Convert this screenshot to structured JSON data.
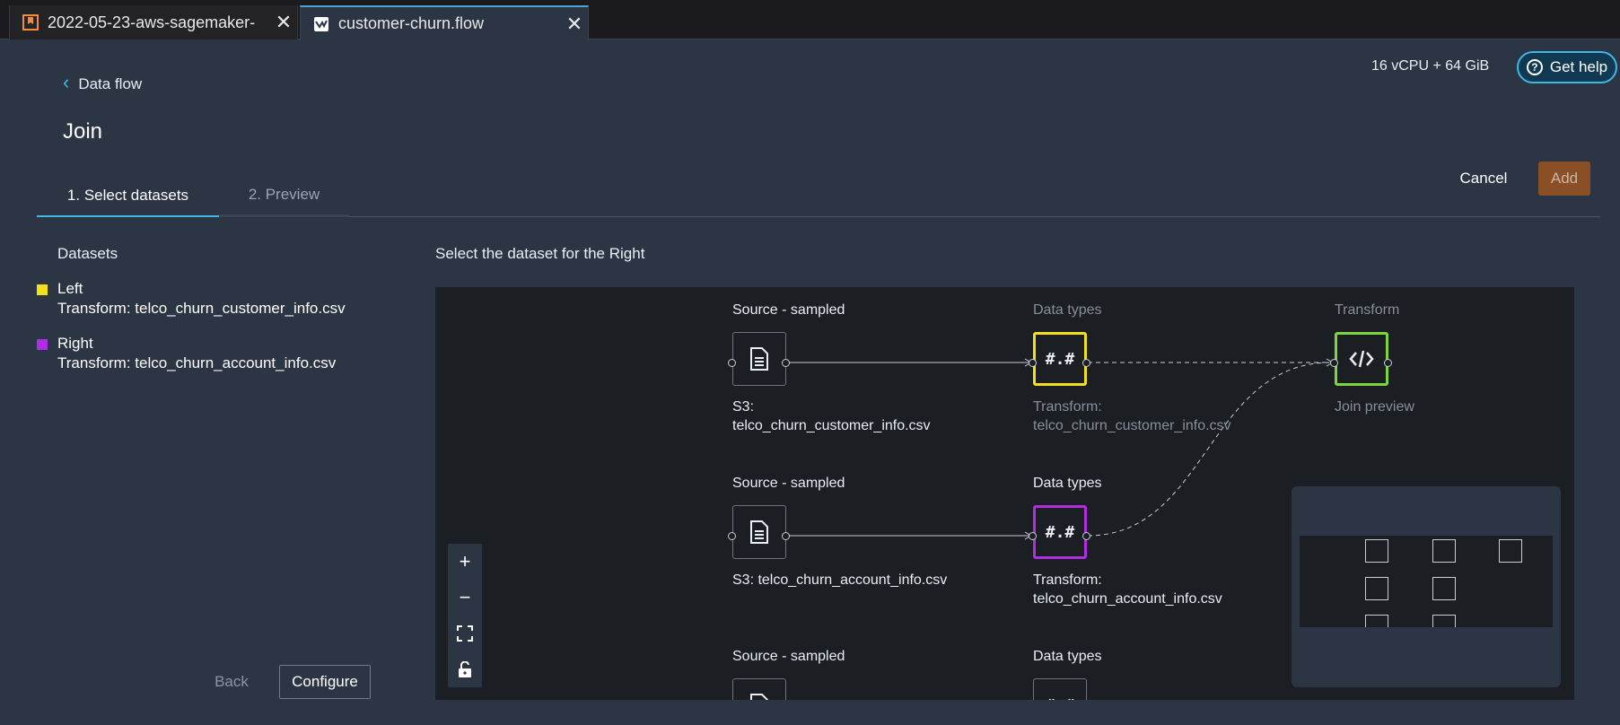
{
  "browser_tabs": [
    {
      "label": "2022-05-23-aws-sagemaker-",
      "icon": "notebook-icon",
      "active": false
    },
    {
      "label": "customer-churn.flow",
      "icon": "flow-icon",
      "active": true
    }
  ],
  "header": {
    "back_link": "Data flow",
    "title": "Join",
    "resource_info": "16 vCPU + 64 GiB",
    "help_label": "Get help"
  },
  "steps": [
    {
      "label": "1. Select datasets",
      "active": true
    },
    {
      "label": "2. Preview",
      "active": false
    }
  ],
  "actions": {
    "cancel_label": "Cancel",
    "add_label": "Add",
    "add_enabled": false
  },
  "datasets_panel": {
    "heading": "Datasets",
    "items": [
      {
        "name": "Left",
        "sub": "Transform: telco_churn_customer_info.csv",
        "color": "#f2e11a"
      },
      {
        "name": "Right",
        "sub": "Transform: telco_churn_account_info.csv",
        "color": "#b12de0"
      }
    ]
  },
  "footer": {
    "back_label": "Back",
    "configure_label": "Configure"
  },
  "canvas": {
    "prompt": "Select the dataset for the Right",
    "rows": [
      {
        "source_heading": "Source - sampled",
        "source_label": "S3:\ntelco_churn_customer_info.csv",
        "dtypes_heading": "Data types",
        "dtypes_glyph": "#.#",
        "dtypes_label": "Transform:\ntelco_churn_customer_info.csv",
        "dtypes_color": "#f2e11a"
      },
      {
        "source_heading": "Source - sampled",
        "source_label": "S3: telco_churn_account_info.csv",
        "dtypes_heading": "Data types",
        "dtypes_glyph": "#.#",
        "dtypes_label": "Transform:\ntelco_churn_account_info.csv",
        "dtypes_color": "#b12de0"
      },
      {
        "source_heading": "Source - sampled",
        "dtypes_heading": "Data types",
        "dtypes_glyph": "#.#"
      }
    ],
    "transform": {
      "heading": "Transform",
      "label": "Join preview",
      "color": "#7fd63c",
      "icon": "code-icon"
    },
    "zoom_controls": [
      "zoom-in-icon",
      "zoom-out-icon",
      "fit-view-icon",
      "lock-icon"
    ]
  }
}
